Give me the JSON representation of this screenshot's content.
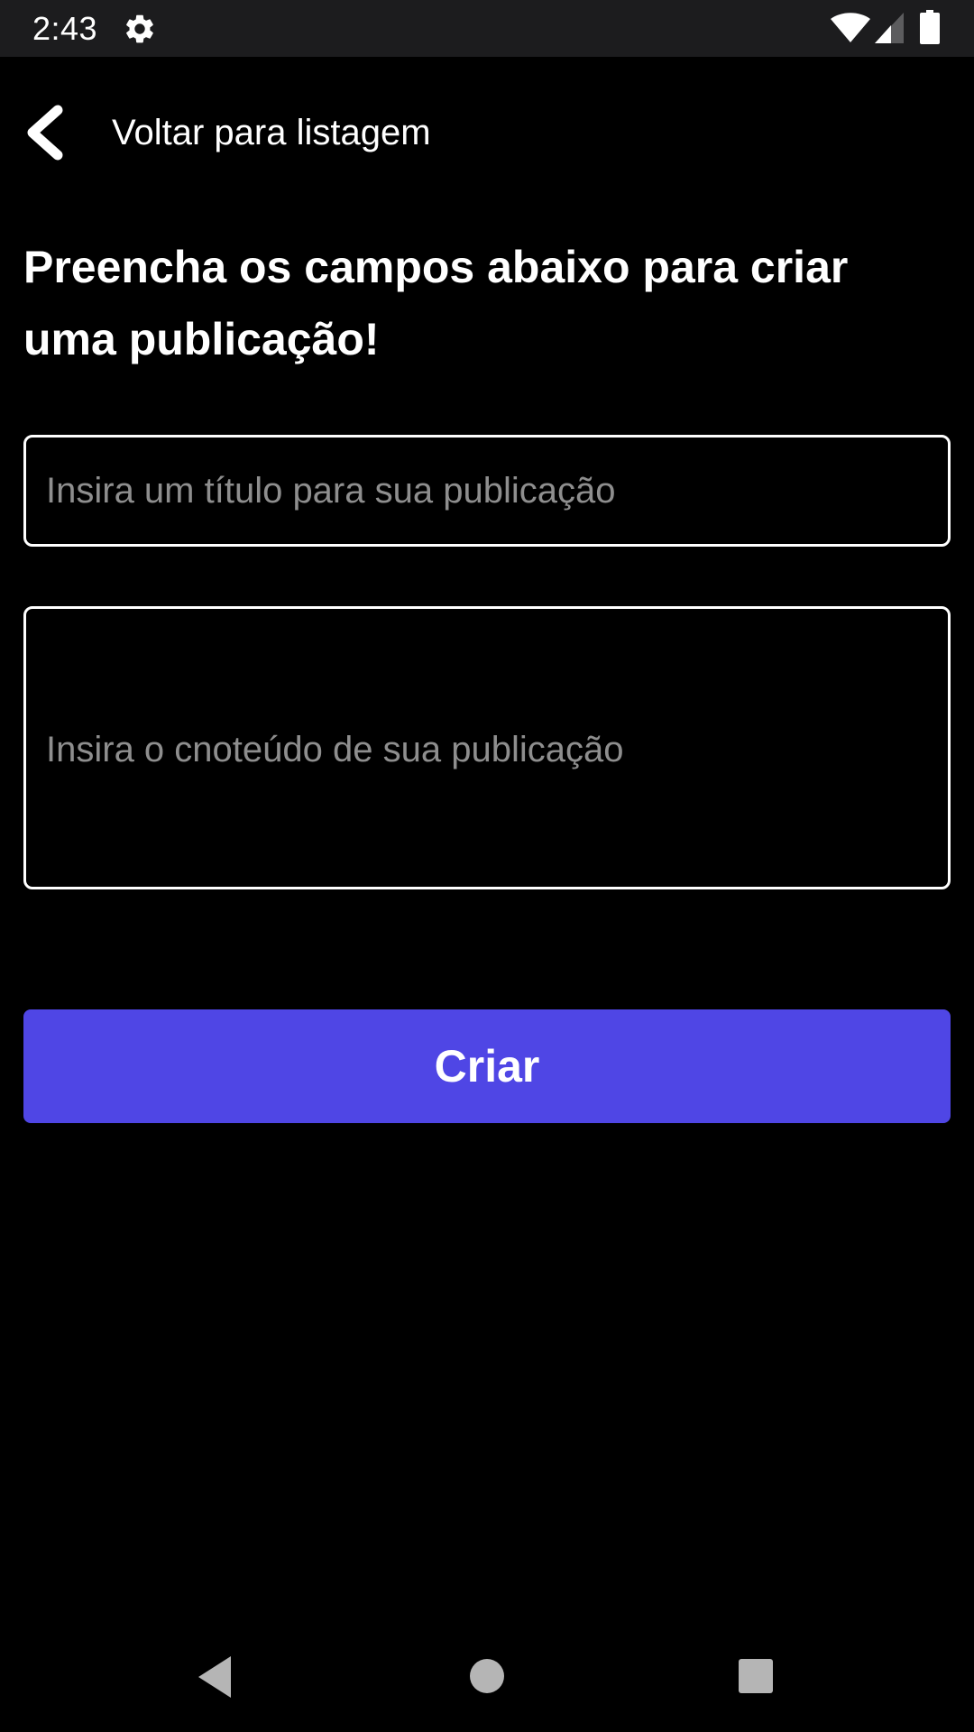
{
  "status_bar": {
    "time": "2:43",
    "icons": [
      "gear-icon",
      "wifi-icon",
      "signal-icon",
      "battery-icon"
    ]
  },
  "back_link": {
    "icon": "chevron-left-icon",
    "label": "Voltar para listagem"
  },
  "page_title": "Preencha os campos abaixo para criar uma publicação!",
  "form": {
    "title_input": {
      "value": "",
      "placeholder": "Insira um título para sua publicação"
    },
    "content_input": {
      "value": "",
      "placeholder": "Insira o cnoteúdo de sua publicação"
    },
    "submit_label": "Criar"
  },
  "nav_bar": {
    "icons": [
      "nav-back-icon",
      "nav-home-icon",
      "nav-recents-icon"
    ]
  },
  "colors": {
    "background": "#000000",
    "status_bar": "#1c1c1e",
    "accent": "#4f46e5",
    "text": "#ffffff",
    "placeholder": "#8e8e8e"
  }
}
